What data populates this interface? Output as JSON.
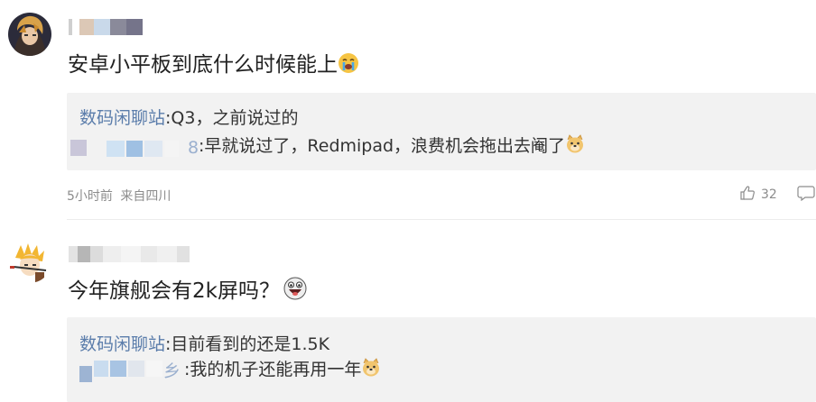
{
  "comments": [
    {
      "text": "安卓小平板到底什么时候能上",
      "emoji": "crying-face-emoji",
      "replies": [
        {
          "author": "数码闲聊站",
          "text": ":Q3，之前说过的"
        },
        {
          "author_fragment": "8",
          "text": ":早就说过了，Redmipad，浪费机会拖出去阉了",
          "emoji": "doge-emoji"
        }
      ],
      "time": "5小时前",
      "location": "来自四川",
      "likes": "32"
    },
    {
      "text": "今年旗舰会有2k屏吗？",
      "emoji": "laughing-face-emoji",
      "replies": [
        {
          "author": "数码闲聊站",
          "text": ":目前看到的还是1.5K"
        },
        {
          "author_fragment": "乡",
          "text": ":我的机子还能再用一年",
          "emoji": "doge-emoji"
        }
      ]
    }
  ],
  "colors": {
    "reply_author": "#5b7dab",
    "reply_bg": "#f2f2f2",
    "meta_text": "#8c8c8c"
  },
  "icons": [
    "thumbs-up-icon",
    "comment-icon"
  ]
}
